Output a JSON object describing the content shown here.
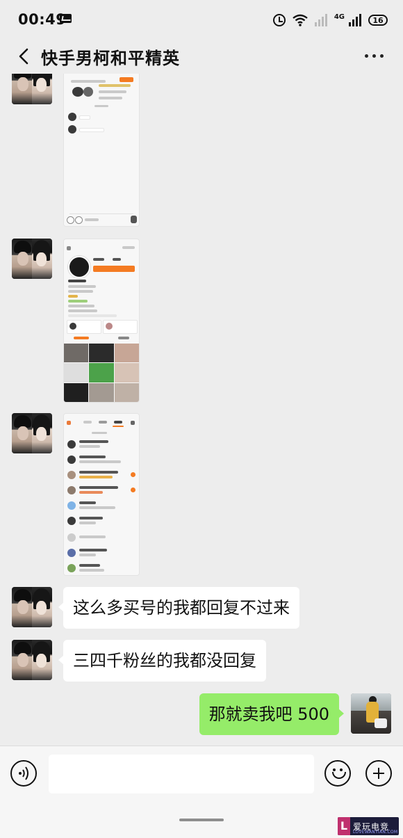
{
  "status_bar": {
    "time": "00:49",
    "network": "4G",
    "battery": "16"
  },
  "header": {
    "title": "快手男柯和平精英"
  },
  "messages": [
    {
      "type": "image",
      "from": "other",
      "content": "screenshot-chat"
    },
    {
      "type": "image",
      "from": "other",
      "content": "screenshot-profile"
    },
    {
      "type": "image",
      "from": "other",
      "content": "screenshot-message-list"
    },
    {
      "type": "text",
      "from": "other",
      "text": "这么多买号的我都回复不过来"
    },
    {
      "type": "text",
      "from": "other",
      "text": "三四千粉丝的我都没回复"
    },
    {
      "type": "text",
      "from": "me",
      "text": "那就卖我吧 500"
    }
  ],
  "input_bar": {
    "placeholder": "",
    "icons": [
      "voice-icon",
      "emoji-icon",
      "plus-icon"
    ]
  },
  "watermark": {
    "logo_letter": "L",
    "text": "爱玩电竞",
    "sub": "LOVEWANYIAN.COM"
  },
  "colors": {
    "background": "#ededed",
    "outgoing_bubble": "#95ec69",
    "incoming_bubble": "#ffffff",
    "accent_orange": "#f47b22"
  }
}
